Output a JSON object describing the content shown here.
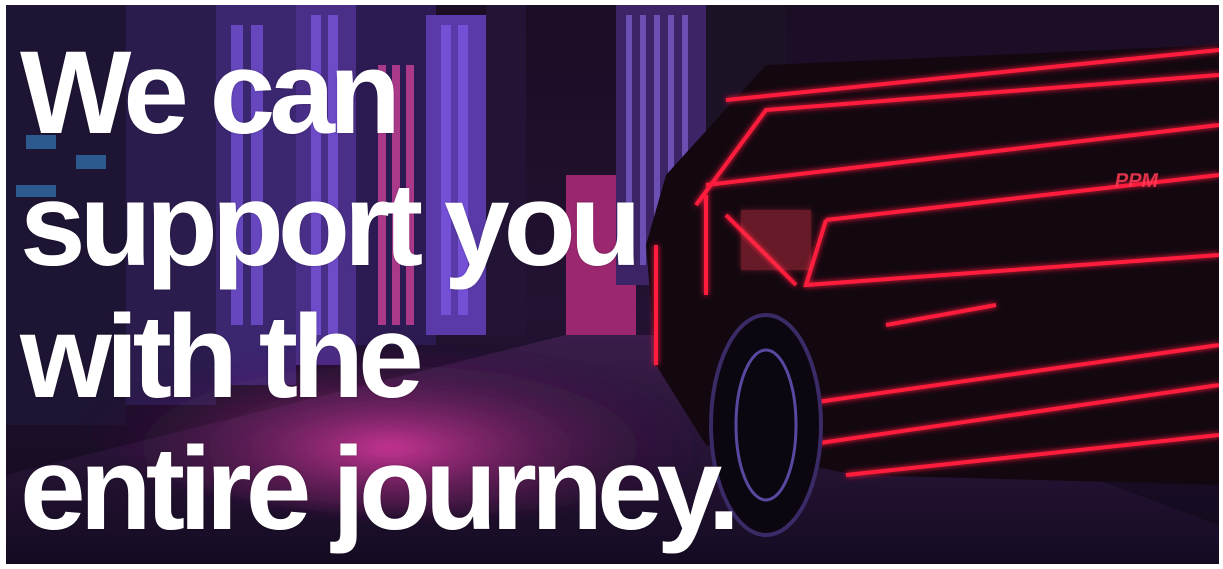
{
  "hero": {
    "headline_lines": [
      "We can",
      "support you",
      "with the",
      "entire journey."
    ],
    "car_badge_text": "PPM",
    "colors": {
      "neon_red": "#ff1a3c",
      "neon_magenta": "#ff2d95",
      "city_purple": "#6a3fd1",
      "sky_dark": "#150a1e",
      "text": "#ffffff"
    }
  }
}
